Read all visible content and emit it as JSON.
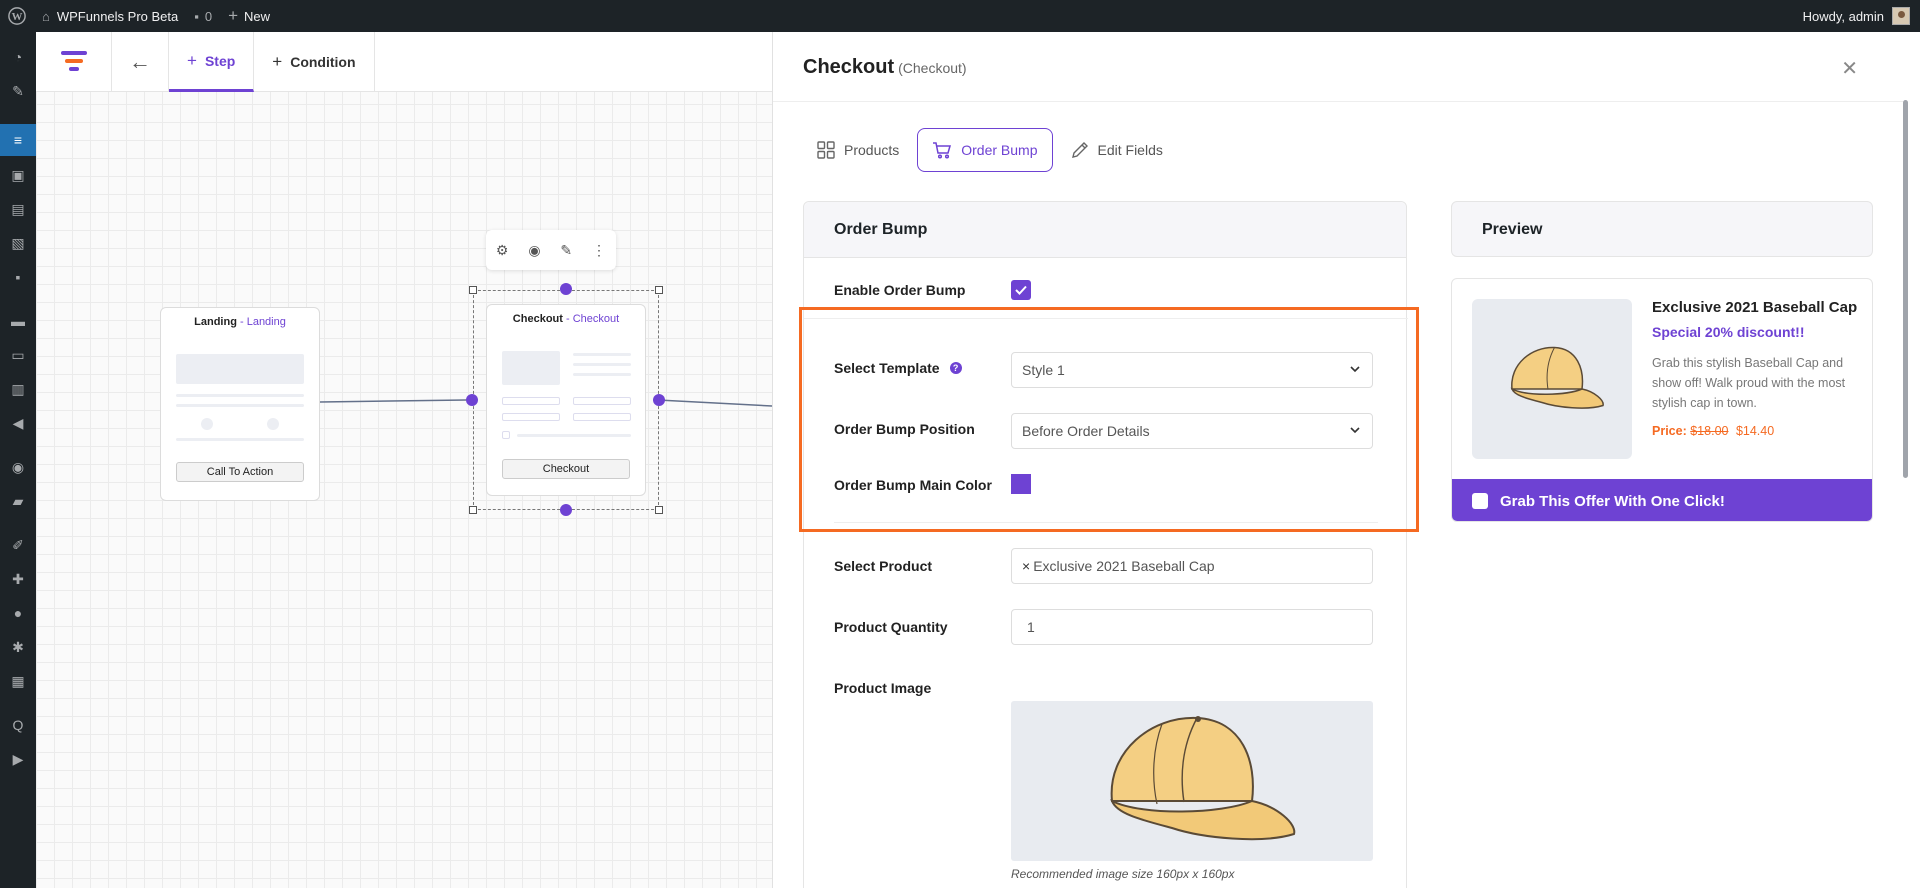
{
  "admin_bar": {
    "site_name": "WPFunnels Pro Beta",
    "comments_count": "0",
    "new_label": "New",
    "greeting": "Howdy, admin"
  },
  "canvas": {
    "tabs": [
      {
        "label": "Step",
        "active": true
      },
      {
        "label": "Condition",
        "active": false
      }
    ],
    "nodes": [
      {
        "title": "Landing",
        "type": "Landing",
        "button": "Call To Action"
      },
      {
        "title": "Checkout",
        "type": "Checkout",
        "button": "Checkout"
      }
    ],
    "node_separator": " - "
  },
  "panel": {
    "title": "Checkout",
    "subtitle": "(Checkout)",
    "tabs": [
      {
        "label": "Products",
        "icon": "grid-icon",
        "active": false
      },
      {
        "label": "Order Bump",
        "icon": "cart-icon",
        "active": true
      },
      {
        "label": "Edit Fields",
        "icon": "pencil-icon",
        "active": false
      }
    ],
    "settings": {
      "heading": "Order Bump",
      "enable_label": "Enable Order Bump",
      "enable_checked": true,
      "template_label": "Select Template",
      "template_help": "?",
      "template_value": "Style 1",
      "position_label": "Order Bump Position",
      "position_value": "Before Order Details",
      "color_label": "Order Bump Main Color",
      "main_color": "#6e42d3",
      "product_label": "Select Product",
      "product_remove": "×",
      "product_value": "Exclusive 2021 Baseball Cap",
      "quantity_label": "Product Quantity",
      "quantity_value": "1",
      "image_label": "Product Image",
      "image_note": "Recommended image size 160px x 160px"
    },
    "preview": {
      "heading": "Preview",
      "product_title": "Exclusive 2021 Baseball Cap",
      "discount_text": "Special 20% discount!!",
      "description": "Grab this stylish Baseball Cap and show off! Walk proud with the most stylish cap in town.",
      "price_label": "Price:",
      "old_price": "$18.00",
      "new_price": "$14.40",
      "cta": "Grab This Offer With One Click!"
    }
  },
  "colors": {
    "accent": "#6e42d3",
    "highlight": "#f56a22",
    "admin_bar": "#1d2327"
  }
}
